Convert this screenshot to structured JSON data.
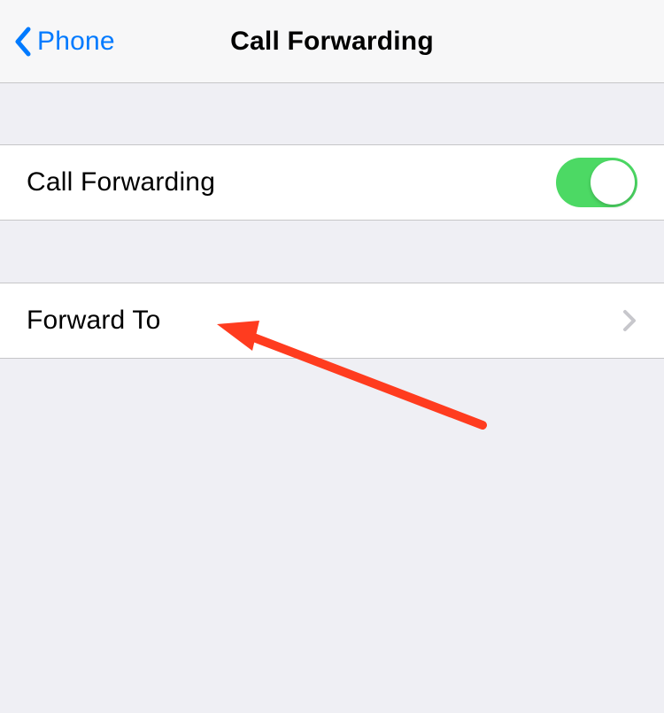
{
  "header": {
    "back_label": "Phone",
    "title": "Call Forwarding"
  },
  "rows": {
    "call_forwarding": {
      "label": "Call Forwarding",
      "toggle_on": true
    },
    "forward_to": {
      "label": "Forward To"
    }
  },
  "colors": {
    "accent": "#007aff",
    "toggle_on": "#4cd964",
    "background": "#efeff4",
    "separator": "#c6c6c8",
    "annotation": "#ff3c1f"
  }
}
